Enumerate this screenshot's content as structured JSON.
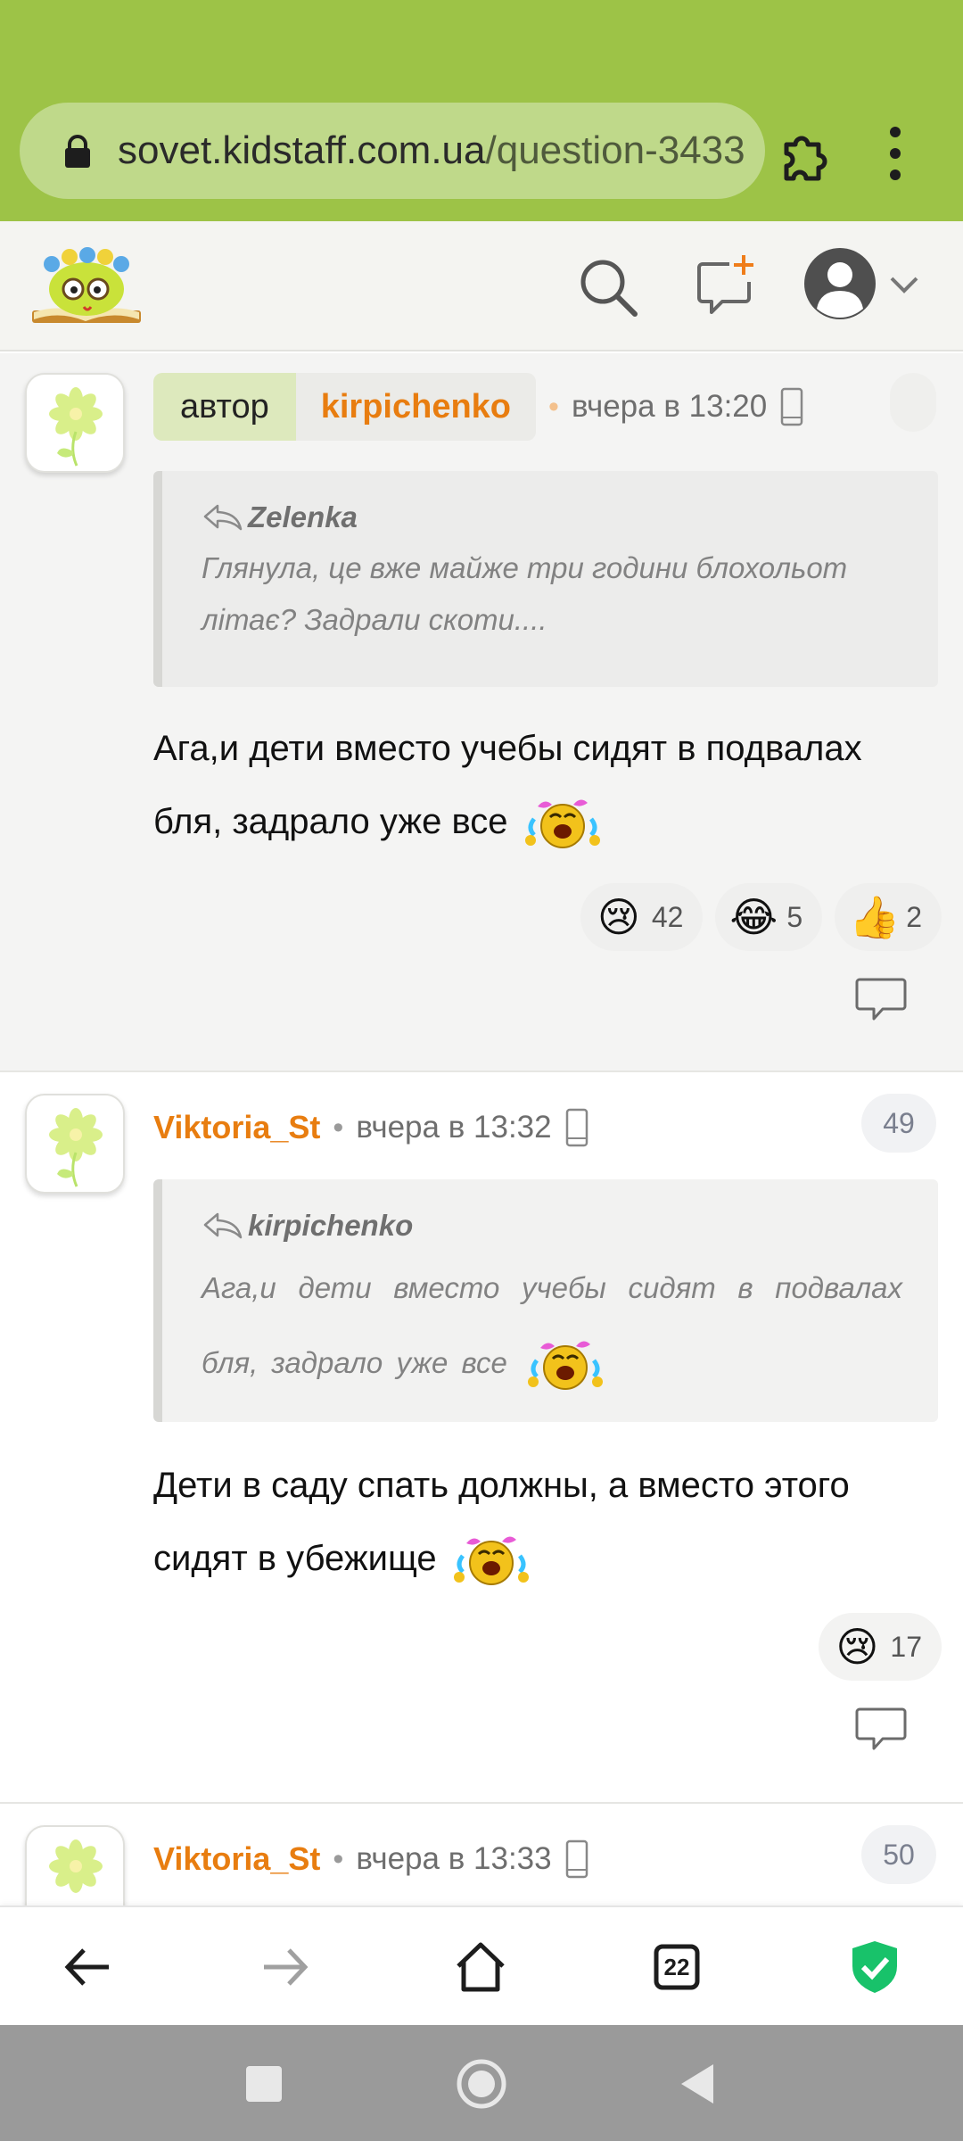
{
  "browser": {
    "url_main": "sovet.kidstaff.com.ua",
    "url_path": "/question-3433",
    "tab_count": "22",
    "colors": {
      "toolbar": "#9dc347",
      "url_pill": "#bfd98a",
      "shield": "#18c26a"
    }
  },
  "header": {
    "logo": "kidstaff-logo",
    "icons": [
      "search-icon",
      "new-question-icon",
      "user-avatar-icon",
      "chevron-down-icon"
    ]
  },
  "comments": [
    {
      "is_author": true,
      "author_label": "автор",
      "username": "kirpichenko",
      "time": "вчера в 13:20",
      "number": "",
      "quote": {
        "author": "Zelenka",
        "text": "Глянула, це вже майже три години блохольот літає? Задрали скоти...."
      },
      "text": "Ага,и дети вместо учебы сидят в подвалах бля, задрало уже все",
      "reactions": [
        {
          "emoji": "😢",
          "count": "42"
        },
        {
          "emoji": "😂",
          "count": "5"
        },
        {
          "emoji": "👍",
          "count": "2"
        }
      ]
    },
    {
      "is_author": false,
      "username": "Viktoria_St",
      "time": "вчера в 13:32",
      "number": "49",
      "quote": {
        "author": "kirpichenko",
        "text": "Ага,и дети вместо учебы сидят в подвалах бля, задрало уже все"
      },
      "text_line1": "Дети в саду спать должны, а вместо этого",
      "text_line2": "сидят в убежище",
      "reactions": [
        {
          "emoji": "😢",
          "count": "17"
        }
      ]
    },
    {
      "is_author": false,
      "username": "Viktoria_St",
      "time": "вчера в 13:33",
      "number": "50"
    }
  ],
  "nav": {
    "buttons": [
      "back-icon",
      "forward-icon",
      "home-icon",
      "tabs-icon",
      "shield-icon"
    ]
  },
  "system_nav": [
    "recents-icon",
    "home-circle-icon",
    "back-triangle-icon"
  ]
}
